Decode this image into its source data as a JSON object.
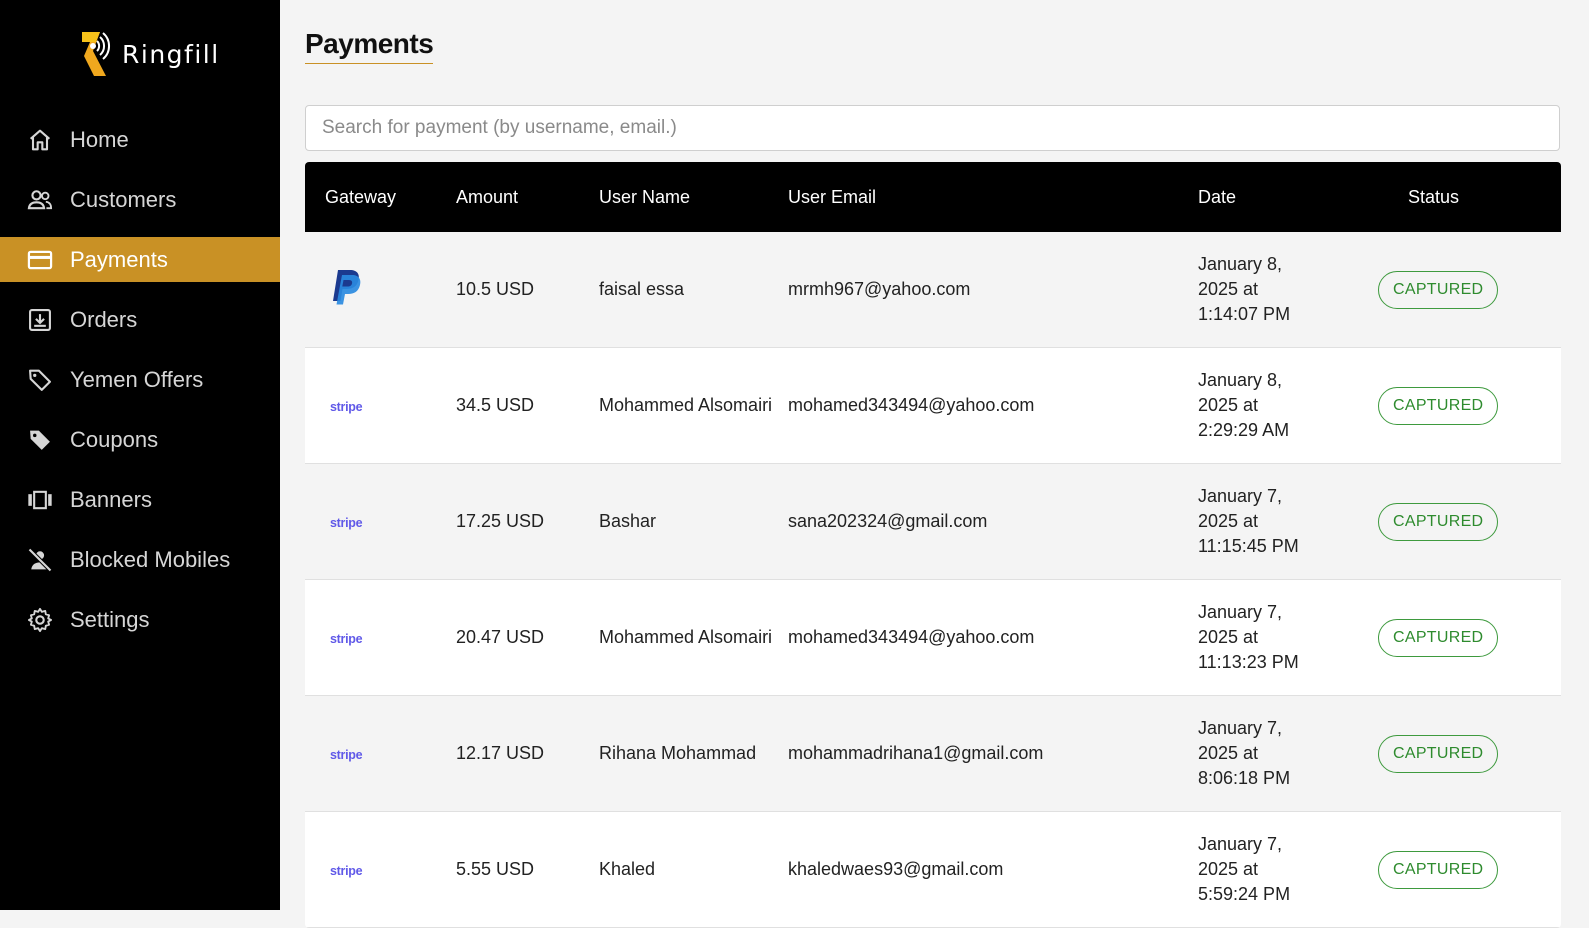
{
  "brand": {
    "name": "Ringfill",
    "accent_color": "#c99125",
    "logo_icon": "ringfill-logo-icon"
  },
  "sidebar": {
    "items": [
      {
        "label": "Home",
        "icon": "home-icon",
        "active": false
      },
      {
        "label": "Customers",
        "icon": "people-icon",
        "active": false
      },
      {
        "label": "Payments",
        "icon": "credit-card-icon",
        "active": true
      },
      {
        "label": "Orders",
        "icon": "download-box-icon",
        "active": false
      },
      {
        "label": "Yemen Offers",
        "icon": "tag-outline-icon",
        "active": false
      },
      {
        "label": "Coupons",
        "icon": "tag-filled-icon",
        "active": false
      },
      {
        "label": "Banners",
        "icon": "carousel-icon",
        "active": false
      },
      {
        "label": "Blocked Mobiles",
        "icon": "person-off-icon",
        "active": false
      },
      {
        "label": "Settings",
        "icon": "gear-icon",
        "active": false
      }
    ]
  },
  "main": {
    "title": "Payments",
    "search": {
      "placeholder": "Search for payment (by username, email.)",
      "value": ""
    },
    "table": {
      "columns": [
        "Gateway",
        "Amount",
        "User Name",
        "User Email",
        "Date",
        "Status"
      ],
      "rows": [
        {
          "gateway": "paypal",
          "amount": "10.5 USD",
          "user_name": "faisal essa",
          "email": "mrmh967@yahoo.com",
          "date": [
            "January 8,",
            "2025 at",
            "1:14:07 PM"
          ],
          "status": "CAPTURED"
        },
        {
          "gateway": "stripe",
          "amount": "34.5 USD",
          "user_name": "Mohammed Alsomairi",
          "email": "mohamed343494@yahoo.com",
          "date": [
            "January 8,",
            "2025 at",
            "2:29:29 AM"
          ],
          "status": "CAPTURED"
        },
        {
          "gateway": "stripe",
          "amount": "17.25 USD",
          "user_name": "Bashar",
          "email": "sana202324@gmail.com",
          "date": [
            "January 7,",
            "2025 at",
            "11:15:45 PM"
          ],
          "status": "CAPTURED"
        },
        {
          "gateway": "stripe",
          "amount": "20.47 USD",
          "user_name": "Mohammed Alsomairi",
          "email": "mohamed343494@yahoo.com",
          "date": [
            "January 7,",
            "2025 at",
            "11:13:23 PM"
          ],
          "status": "CAPTURED"
        },
        {
          "gateway": "stripe",
          "amount": "12.17 USD",
          "user_name": "Rihana Mohammad",
          "email": "mohammadrihana1@gmail.com",
          "date": [
            "January 7,",
            "2025 at",
            "8:06:18 PM"
          ],
          "status": "CAPTURED"
        },
        {
          "gateway": "stripe",
          "amount": "5.55 USD",
          "user_name": "Khaled",
          "email": "khaledwaes93@gmail.com",
          "date": [
            "January 7,",
            "2025 at",
            "5:59:24 PM"
          ],
          "status": "CAPTURED"
        }
      ]
    }
  },
  "gateway_labels": {
    "stripe": "stripe"
  },
  "colors": {
    "sidebar_bg": "#000000",
    "status_green": "#2e8b2e",
    "stripe_purple": "#6059e8",
    "paypal_dark": "#1b3a8f",
    "paypal_light": "#2a8ae0"
  }
}
